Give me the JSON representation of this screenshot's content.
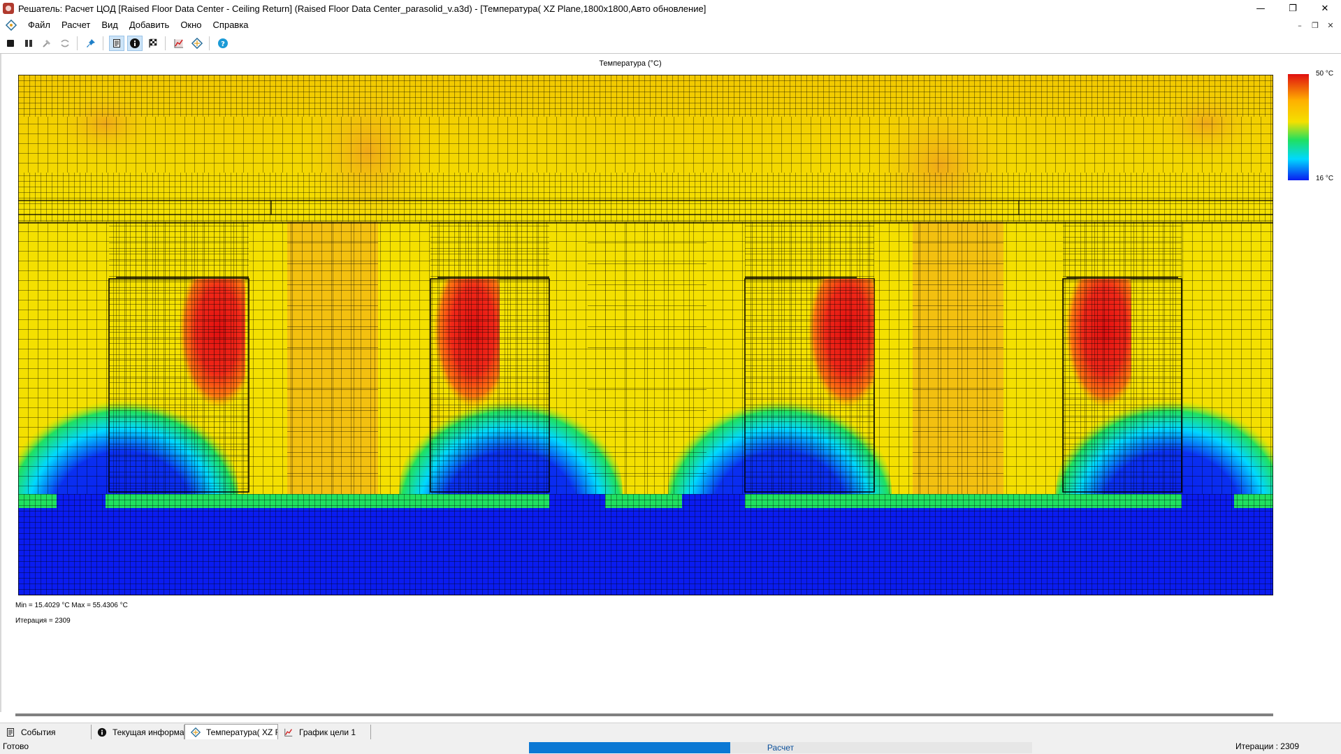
{
  "window": {
    "title": "Решатель: Расчет ЦОД [Raised Floor Data Center - Ceiling Return] (Raised Floor Data Center_parasolid_v.a3d) - [Температура( XZ Plane,1800x1800,Авто обновление]",
    "minimize": "—",
    "maximize": "❐",
    "close": "✕"
  },
  "menu": {
    "items": [
      "Файл",
      "Расчет",
      "Вид",
      "Добавить",
      "Окно",
      "Справка"
    ],
    "mdi_minimize": "–",
    "mdi_restore": "❐",
    "mdi_close": "✕"
  },
  "toolbar": {
    "icons": [
      "stop-icon",
      "pause-icon",
      "hammer-icon",
      "undo-arrows-icon",
      "pin-icon",
      "document-icon",
      "info-icon",
      "checkered-flag-icon",
      "chart-icon",
      "mesh-icon",
      "help-icon"
    ]
  },
  "plot": {
    "title": "Температура (°C)",
    "legend_max": "50 °C",
    "legend_min": "16 °C",
    "minmax_text": "Min = 15.4029 °C   Max = 55.4306 °C",
    "iteration_text": "Итерация = 2309",
    "colors": {
      "cold": "#0a1cf0",
      "cool": "#00e6ff",
      "mid": "#20e060",
      "warm": "#f0e000",
      "hot": "#ff9a10",
      "hottest": "#e01010"
    }
  },
  "tabs": [
    {
      "label": "События",
      "icon": "document-icon"
    },
    {
      "label": "Текущая информац",
      "icon": "info-icon"
    },
    {
      "label": "Температура( XZ F",
      "icon": "mesh-icon"
    },
    {
      "label": "График цели 1",
      "icon": "chart-icon"
    }
  ],
  "status": {
    "left": "Готово",
    "progress_label": "Расчет",
    "progress_value": 0.4,
    "right": "Итерации : 2309"
  }
}
